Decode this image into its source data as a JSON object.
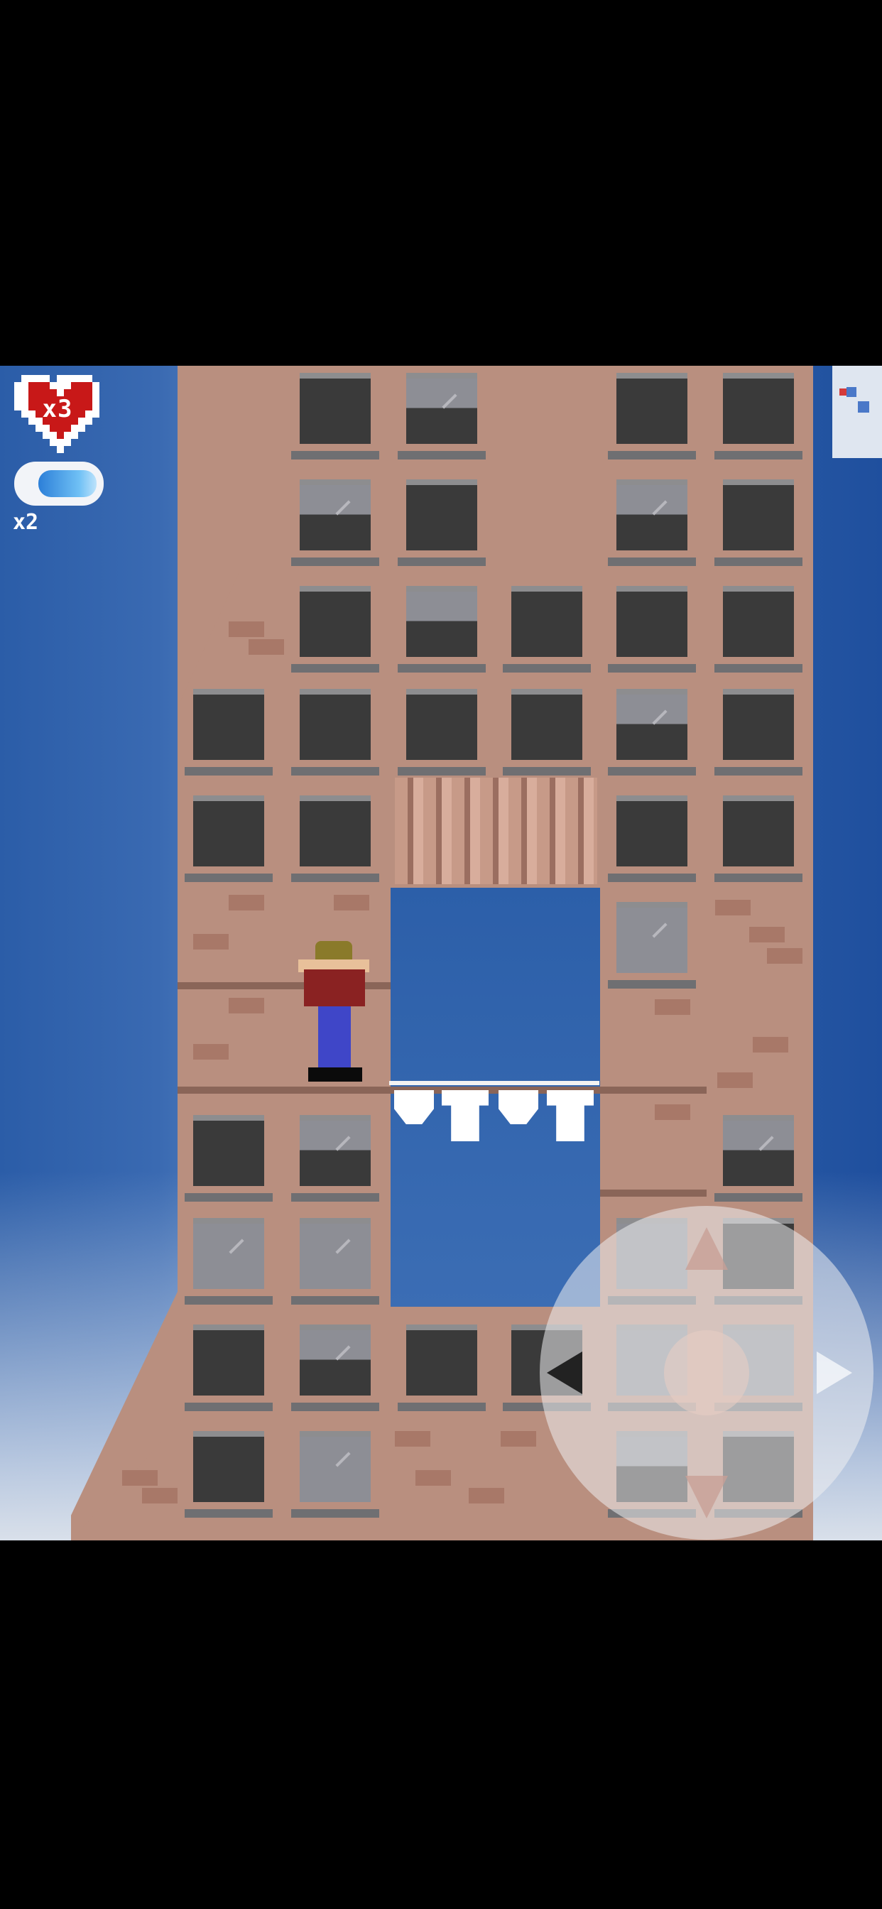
{
  "hud": {
    "lives_label": "x3",
    "item_label": "x2",
    "heart_color": "#c81818",
    "item_color": "#4aa3ee",
    "pause_icon": "pause-icon"
  },
  "controls": {
    "dpad_icon": "dpad-icon",
    "directions": [
      "up",
      "down",
      "left",
      "right"
    ]
  },
  "scene": {
    "sky_color": "#2f62aa",
    "building_color": "#b98f7f",
    "window_color": "#3a3a3a"
  }
}
